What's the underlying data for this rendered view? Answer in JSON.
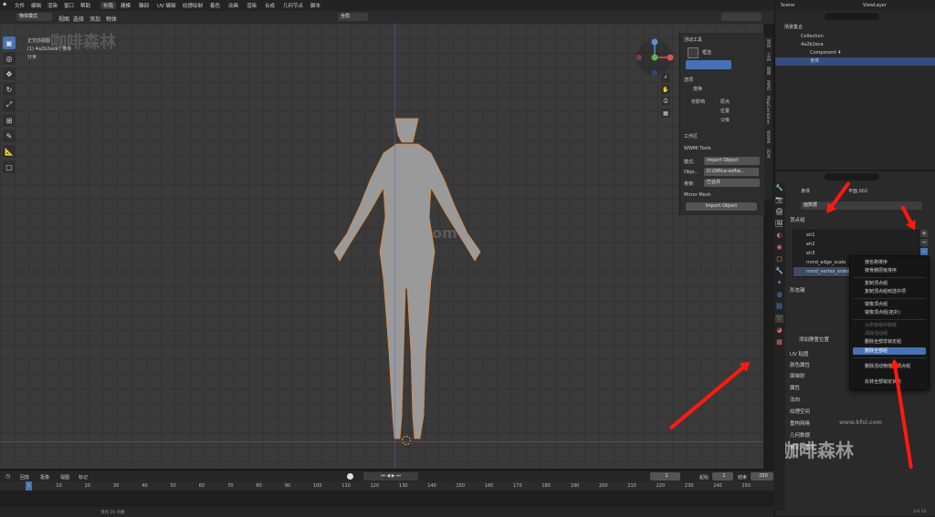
{
  "topbar": {
    "menus": [
      "文件",
      "编辑",
      "渲染",
      "窗口",
      "帮助"
    ],
    "workspaces": [
      "布局",
      "建模",
      "雕刻",
      "UV 编辑",
      "纹理绘制",
      "着色",
      "动画",
      "渲染",
      "合成",
      "几何节点",
      "脚本"
    ],
    "scene": "Scene",
    "view_layer": "ViewLayer"
  },
  "viewport_header": {
    "mode": "物体模式",
    "menus": [
      "视图",
      "选择",
      "添加",
      "物体"
    ],
    "transform": "全局",
    "select_label": "选项"
  },
  "overlay_text": {
    "view": "正交前视图",
    "collection": "(1) 4a2b2eca | 身体",
    "units": "分米"
  },
  "watermarks": {
    "tl": "咖啡森林",
    "center": "kfsl.com",
    "br": "咖啡森林",
    "br_url": "www.kfsl.com"
  },
  "npanel": {
    "active_tool": "活动工具",
    "tool_name": "框选",
    "options": "选项",
    "transform": "变换",
    "affect_only": "仅影响",
    "origins": "原点",
    "locations": "位置",
    "parents": "父级",
    "workspace": "工作区",
    "wwmi": "WWMI Tools",
    "mode_label": "模式:",
    "mode_value": "Import Object",
    "obj_label": "Obje...",
    "obj_value": "D:\\Office-softw...",
    "slot_label": "骨架:",
    "slot_value": "已合并",
    "mirror": "Mirror Mesh",
    "import_btn": "Import Object",
    "tabs": [
      "项目",
      "工具",
      "视图",
      "MMD",
      "MapCombiner",
      "WWMI",
      "3DM"
    ]
  },
  "outliner": {
    "title": "场景集合",
    "items": [
      {
        "label": "Collection",
        "depth": 1
      },
      {
        "label": "4a2b2eca",
        "depth": 1
      },
      {
        "label": "Component 4",
        "depth": 2
      },
      {
        "label": "身体",
        "depth": 2
      }
    ]
  },
  "properties": {
    "breadcrumb_obj": "身体",
    "breadcrumb_mesh": "平面.002",
    "mesh_name": "面数据",
    "vertex_groups_header": "顶点组",
    "vertex_groups": [
      "eh1",
      "eh2",
      "eh3",
      "mmd_edge_scale",
      "mmd_vertex_order"
    ],
    "shape_keys": "形态键",
    "add_rest": "添加静置位置",
    "sections": [
      "UV 贴图",
      "颜色属性",
      "面映射",
      "属性",
      "法向",
      "纹理空间",
      "重构网格",
      "几何数据",
      "自定义属性"
    ]
  },
  "context_menu": {
    "items": [
      {
        "label": "按名称排序",
        "state": "normal"
      },
      {
        "label": "按骨骼层级排序",
        "state": "normal"
      },
      {
        "label": "复制顶点组",
        "state": "normal"
      },
      {
        "label": "复制顶点组到选中项",
        "state": "normal"
      },
      {
        "label": "镜像顶点组",
        "state": "normal"
      },
      {
        "label": "镜像顶点组(拓扑)",
        "state": "normal"
      },
      {
        "label": "从所有组中移除",
        "state": "disabled"
      },
      {
        "label": "清除活动组",
        "state": "disabled"
      },
      {
        "label": "删除全部非锁定组",
        "state": "normal"
      },
      {
        "label": "删除全部组",
        "state": "highlight"
      },
      {
        "label": "删除活动物体的顶点组",
        "state": "normal"
      },
      {
        "label": "反转全部锁定状态",
        "state": "normal"
      }
    ]
  },
  "timeline": {
    "menus": [
      "回放",
      "抠像",
      "视图",
      "标记"
    ],
    "current_frame": "1",
    "start_label": "起始",
    "start": "1",
    "end_label": "结束",
    "end": "250",
    "ticks": [
      "1",
      "10",
      "20",
      "30",
      "40",
      "50",
      "60",
      "70",
      "80",
      "90",
      "100",
      "110",
      "120",
      "130",
      "140",
      "150",
      "160",
      "170",
      "180",
      "190",
      "200",
      "210",
      "220",
      "230",
      "240",
      "250"
    ],
    "status": "顶点 20 点数",
    "version": "3.6.15"
  }
}
